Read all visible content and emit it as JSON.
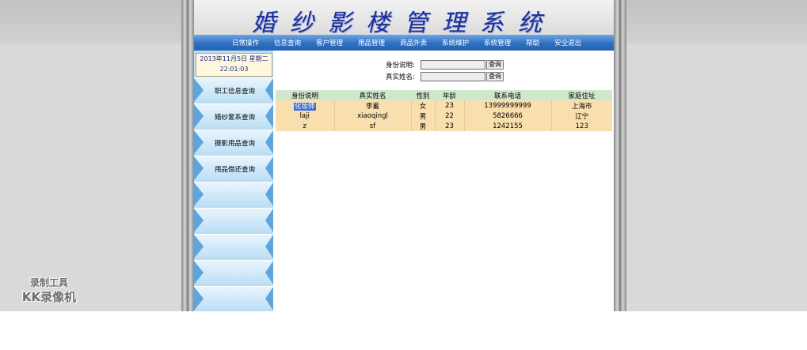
{
  "header": {
    "title": "婚纱影楼管理系统"
  },
  "menu": [
    {
      "label": "日常操作"
    },
    {
      "label": "信息查询"
    },
    {
      "label": "客户管理"
    },
    {
      "label": "用品管理"
    },
    {
      "label": "商品外卖"
    },
    {
      "label": "系统维护"
    },
    {
      "label": "系统管理"
    },
    {
      "label": "帮助"
    },
    {
      "label": "安全退出"
    }
  ],
  "sidebar": {
    "date": "2013年11月5日  星期二",
    "time": "22:01:03",
    "items": [
      {
        "label": "职工信息查询"
      },
      {
        "label": "婚纱套系查询"
      },
      {
        "label": "摄影用品查询"
      },
      {
        "label": "用品借还查询"
      }
    ]
  },
  "search": {
    "id_label": "身份说明:",
    "name_label": "真实姓名:",
    "id_value": "",
    "name_value": "",
    "button_label": "查询"
  },
  "table": {
    "columns": [
      "身份说明",
      "真实姓名",
      "性别",
      "年龄",
      "联系电话",
      "家庭住址"
    ],
    "rows": [
      [
        "化妆师",
        "李蓄",
        "女",
        "23",
        "13999999999",
        "上海市"
      ],
      [
        "laji",
        "xiaoqingl",
        "男",
        "22",
        "5826666",
        "辽宁"
      ],
      [
        "z",
        "sf",
        "男",
        "23",
        "1242155",
        "123"
      ]
    ]
  },
  "watermark": {
    "line1": "录制工具",
    "line2": "KK录像机"
  }
}
